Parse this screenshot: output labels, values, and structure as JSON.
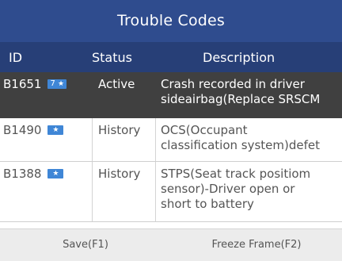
{
  "title": "Trouble Codes",
  "columns": {
    "id": "ID",
    "status": "Status",
    "description": "Description"
  },
  "rows": [
    {
      "code": "B1651",
      "badge_number": "7",
      "badge_symbol": "★",
      "status": "Active",
      "description_line1": "Crash recorded in driver",
      "description_line2": "sideairbag(Replace SRSCM"
    },
    {
      "code": "B1490",
      "badge_symbol": "★",
      "status": "History",
      "description_line1": "OCS(Occupant",
      "description_line2": "classification system)defet"
    },
    {
      "code": "B1388",
      "badge_symbol": "★",
      "status": "History",
      "description_line1": "STPS(Seat track positiom",
      "description_line2": "sensor)-Driver open or",
      "description_line3": "short to battery"
    }
  ],
  "footer": {
    "save_label": "Save(F1)",
    "freeze_label": "Freeze Frame(F2)"
  },
  "colors": {
    "title_bar": "#2f4c8e",
    "header_row": "#273f77",
    "active_row": "#404040",
    "badge": "#3f86d6",
    "footer": "#ececec"
  },
  "icons": {
    "badge": "star-badge-icon"
  }
}
